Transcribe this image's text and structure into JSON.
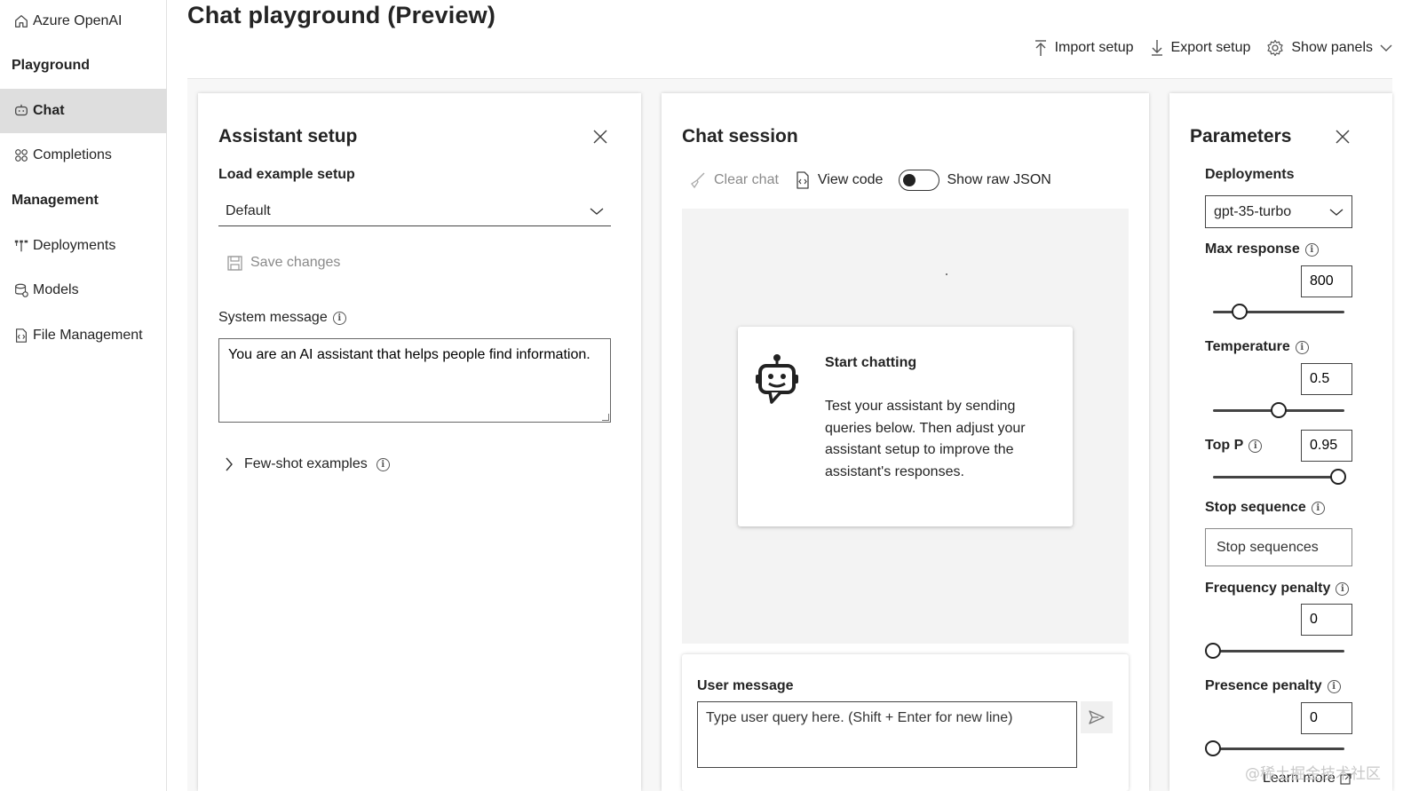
{
  "sidebar": {
    "app_title": "Azure OpenAI",
    "section_playground": "Playground",
    "chat": "Chat",
    "completions": "Completions",
    "section_management": "Management",
    "deployments": "Deployments",
    "models": "Models",
    "file_management": "File Management"
  },
  "header": {
    "title": "Chat playground (Preview)",
    "import_setup": "Import setup",
    "export_setup": "Export setup",
    "show_panels": "Show panels"
  },
  "assistant": {
    "title": "Assistant setup",
    "load_example_label": "Load example setup",
    "example_value": "Default",
    "save_changes": "Save changes",
    "system_message_label": "System message",
    "system_message_value": "You are an AI assistant that helps people find information.",
    "few_shot_label": "Few-shot examples"
  },
  "chat": {
    "title": "Chat session",
    "clear_chat": "Clear chat",
    "view_code": "View code",
    "show_raw_json": "Show raw JSON",
    "show_raw_json_on": false,
    "start_title": "Start chatting",
    "start_desc": "Test your assistant by sending queries below. Then adjust your assistant setup to improve the assistant's responses.",
    "user_message_label": "User message",
    "user_message_placeholder": "Type user query here. (Shift + Enter for new line)"
  },
  "params": {
    "title": "Parameters",
    "deployments_label": "Deployments",
    "deployment_value": "gpt-35-turbo",
    "max_response_label": "Max response",
    "max_response_value": "800",
    "max_response_fraction": 0.2,
    "temperature_label": "Temperature",
    "temperature_value": "0.5",
    "temperature_fraction": 0.5,
    "top_p_label": "Top P",
    "top_p_value": "0.95",
    "top_p_fraction": 0.95,
    "stop_sequence_label": "Stop sequence",
    "stop_sequence_placeholder": "Stop sequences",
    "frequency_penalty_label": "Frequency penalty",
    "frequency_penalty_value": "0",
    "frequency_penalty_fraction": 0,
    "presence_penalty_label": "Presence penalty",
    "presence_penalty_value": "0",
    "presence_penalty_fraction": 0,
    "learn_more": "Learn more"
  },
  "watermark": "@稀土掘金技术社区",
  "icons": {
    "app": "home-icon",
    "chat": "chat-icon",
    "completions": "completions-icon",
    "deployments": "deployments-icon",
    "models": "models-icon",
    "file_management": "file-icon"
  }
}
